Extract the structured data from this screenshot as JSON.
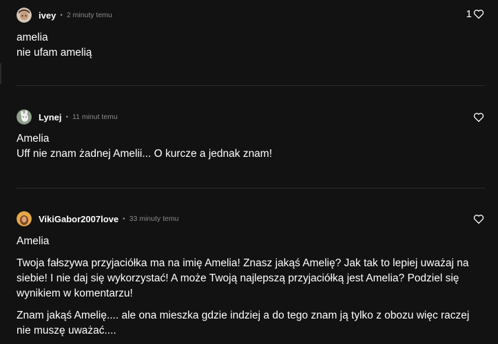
{
  "comments": [
    {
      "username": "ivey",
      "separator": "•",
      "time": "2 minuty temu",
      "like_count": "1",
      "lines": [
        "amelia",
        "nie ufam amelią"
      ],
      "avatar_icon": "profile-photo"
    },
    {
      "username": "Lynej",
      "separator": "•",
      "time": "11 minut temu",
      "lines": [
        "Amelia",
        "Uff nie znam żadnej Amelii... O kurcze a jednak znam!"
      ],
      "avatar_icon": "profile-photo"
    },
    {
      "username": "VikiGabor2007love",
      "separator": "•",
      "time": "33 minuty temu",
      "title_line": "Amelia",
      "paragraphs": [
        "Twoja fałszywa przyjaciółka ma na imię Amelia! Znasz jakąś Amelię? Jak tak to lepiej uważaj na siebie! I nie daj się wykorzystać! A może Twoją najlepszą przyjaciółką jest Amelia? Podziel się wynikiem w komentarzu!",
        "Znam jakąś Amelię.... ale ona mieszka gdzie indziej a do tego znam ją tylko z obozu więc raczej nie muszę uważać...."
      ],
      "avatar_icon": "profile-photo"
    }
  ],
  "colors": {
    "background": "#121212",
    "text": "#ffffff",
    "muted": "#8a8a8a",
    "divider": "#2b2b2b"
  },
  "icons": {
    "like": "heart-outline-icon"
  }
}
